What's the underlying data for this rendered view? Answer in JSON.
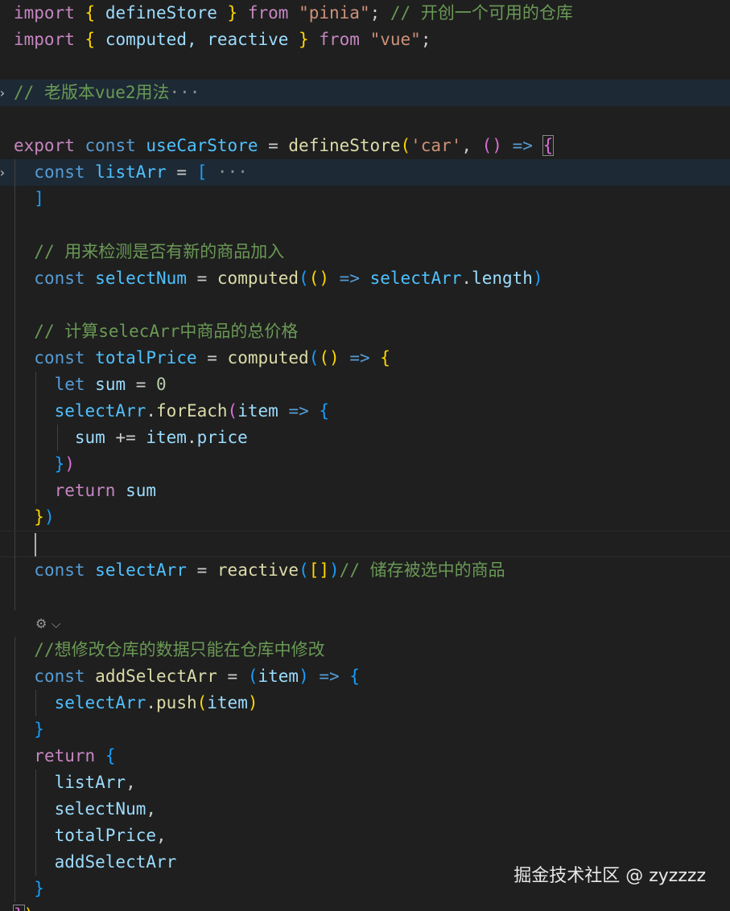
{
  "editor": {
    "lines": [
      {
        "fold": "",
        "guides": [],
        "tokens": [
          {
            "t": "import",
            "c": "kw-purple"
          },
          {
            "t": " ",
            "c": "plain"
          },
          {
            "t": "{",
            "c": "br1"
          },
          {
            "t": " defineStore ",
            "c": "var"
          },
          {
            "t": "}",
            "c": "br1"
          },
          {
            "t": " ",
            "c": "plain"
          },
          {
            "t": "from",
            "c": "kw-purple"
          },
          {
            "t": " ",
            "c": "plain"
          },
          {
            "t": "\"pinia\"",
            "c": "str"
          },
          {
            "t": "; ",
            "c": "plain"
          },
          {
            "t": "// 开创一个可用的仓库",
            "c": "cm"
          }
        ]
      },
      {
        "fold": "",
        "guides": [],
        "tokens": [
          {
            "t": "import",
            "c": "kw-purple"
          },
          {
            "t": " ",
            "c": "plain"
          },
          {
            "t": "{",
            "c": "br1"
          },
          {
            "t": " computed, reactive ",
            "c": "var"
          },
          {
            "t": "}",
            "c": "br1"
          },
          {
            "t": " ",
            "c": "plain"
          },
          {
            "t": "from",
            "c": "kw-purple"
          },
          {
            "t": " ",
            "c": "plain"
          },
          {
            "t": "\"vue\"",
            "c": "str"
          },
          {
            "t": ";",
            "c": "plain"
          }
        ]
      },
      {
        "fold": "",
        "guides": [],
        "tokens": []
      },
      {
        "fold": "›",
        "guides": [],
        "hl": true,
        "tokens": [
          {
            "t": "// 老版本vue2用法",
            "c": "cm"
          },
          {
            "t": "···",
            "c": "ellipsis"
          }
        ]
      },
      {
        "fold": "",
        "guides": [],
        "tokens": []
      },
      {
        "fold": "",
        "guides": [],
        "tokens": [
          {
            "t": "export",
            "c": "kw-purple"
          },
          {
            "t": " ",
            "c": "plain"
          },
          {
            "t": "const",
            "c": "kw-blue"
          },
          {
            "t": " ",
            "c": "plain"
          },
          {
            "t": "useCarStore",
            "c": "const"
          },
          {
            "t": " = ",
            "c": "plain"
          },
          {
            "t": "defineStore",
            "c": "fn"
          },
          {
            "t": "(",
            "c": "br1"
          },
          {
            "t": "'car'",
            "c": "str"
          },
          {
            "t": ", ",
            "c": "plain"
          },
          {
            "t": "()",
            "c": "br2"
          },
          {
            "t": " ",
            "c": "plain"
          },
          {
            "t": "=>",
            "c": "kw-blue"
          },
          {
            "t": " ",
            "c": "plain"
          },
          {
            "t": "{",
            "c": "br2",
            "box": true
          }
        ]
      },
      {
        "fold": "›",
        "guides": [
          1
        ],
        "hl": true,
        "tokens": [
          {
            "t": "  ",
            "c": "plain"
          },
          {
            "t": "const",
            "c": "kw-blue"
          },
          {
            "t": " ",
            "c": "plain"
          },
          {
            "t": "listArr",
            "c": "const"
          },
          {
            "t": " = ",
            "c": "plain"
          },
          {
            "t": "[",
            "c": "br3"
          },
          {
            "t": " ···",
            "c": "ellipsis"
          }
        ]
      },
      {
        "fold": "",
        "guides": [
          1
        ],
        "tokens": [
          {
            "t": "  ",
            "c": "plain"
          },
          {
            "t": "]",
            "c": "br3"
          }
        ]
      },
      {
        "fold": "",
        "guides": [
          1
        ],
        "tokens": []
      },
      {
        "fold": "",
        "guides": [
          1
        ],
        "tokens": [
          {
            "t": "  ",
            "c": "plain"
          },
          {
            "t": "// 用来检测是否有新的商品加入",
            "c": "cm"
          }
        ]
      },
      {
        "fold": "",
        "guides": [
          1
        ],
        "tokens": [
          {
            "t": "  ",
            "c": "plain"
          },
          {
            "t": "const",
            "c": "kw-blue"
          },
          {
            "t": " ",
            "c": "plain"
          },
          {
            "t": "selectNum",
            "c": "const"
          },
          {
            "t": " = ",
            "c": "plain"
          },
          {
            "t": "computed",
            "c": "fn"
          },
          {
            "t": "(",
            "c": "br3"
          },
          {
            "t": "()",
            "c": "br1"
          },
          {
            "t": " ",
            "c": "plain"
          },
          {
            "t": "=>",
            "c": "kw-blue"
          },
          {
            "t": " ",
            "c": "plain"
          },
          {
            "t": "selectArr",
            "c": "const"
          },
          {
            "t": ".",
            "c": "plain"
          },
          {
            "t": "length",
            "c": "var"
          },
          {
            "t": ")",
            "c": "br3"
          }
        ]
      },
      {
        "fold": "",
        "guides": [
          1
        ],
        "tokens": []
      },
      {
        "fold": "",
        "guides": [
          1
        ],
        "tokens": [
          {
            "t": "  ",
            "c": "plain"
          },
          {
            "t": "// 计算selecArr中商品的总价格",
            "c": "cm"
          }
        ]
      },
      {
        "fold": "",
        "guides": [
          1
        ],
        "tokens": [
          {
            "t": "  ",
            "c": "plain"
          },
          {
            "t": "const",
            "c": "kw-blue"
          },
          {
            "t": " ",
            "c": "plain"
          },
          {
            "t": "totalPrice",
            "c": "const"
          },
          {
            "t": " = ",
            "c": "plain"
          },
          {
            "t": "computed",
            "c": "fn"
          },
          {
            "t": "(",
            "c": "br3"
          },
          {
            "t": "()",
            "c": "br1"
          },
          {
            "t": " ",
            "c": "plain"
          },
          {
            "t": "=>",
            "c": "kw-blue"
          },
          {
            "t": " ",
            "c": "plain"
          },
          {
            "t": "{",
            "c": "br1"
          }
        ]
      },
      {
        "fold": "",
        "guides": [
          1,
          2
        ],
        "tokens": [
          {
            "t": "    ",
            "c": "plain"
          },
          {
            "t": "let",
            "c": "kw-blue"
          },
          {
            "t": " ",
            "c": "plain"
          },
          {
            "t": "sum",
            "c": "var"
          },
          {
            "t": " = ",
            "c": "plain"
          },
          {
            "t": "0",
            "c": "num"
          }
        ]
      },
      {
        "fold": "",
        "guides": [
          1,
          2
        ],
        "tokens": [
          {
            "t": "    ",
            "c": "plain"
          },
          {
            "t": "selectArr",
            "c": "const"
          },
          {
            "t": ".",
            "c": "plain"
          },
          {
            "t": "forEach",
            "c": "fn"
          },
          {
            "t": "(",
            "c": "br2"
          },
          {
            "t": "item",
            "c": "var"
          },
          {
            "t": " ",
            "c": "plain"
          },
          {
            "t": "=>",
            "c": "kw-blue"
          },
          {
            "t": " ",
            "c": "plain"
          },
          {
            "t": "{",
            "c": "br3"
          }
        ]
      },
      {
        "fold": "",
        "guides": [
          1,
          2,
          3
        ],
        "tokens": [
          {
            "t": "      ",
            "c": "plain"
          },
          {
            "t": "sum",
            "c": "var"
          },
          {
            "t": " += ",
            "c": "plain"
          },
          {
            "t": "item",
            "c": "var"
          },
          {
            "t": ".",
            "c": "plain"
          },
          {
            "t": "price",
            "c": "var"
          }
        ]
      },
      {
        "fold": "",
        "guides": [
          1,
          2
        ],
        "tokens": [
          {
            "t": "    ",
            "c": "plain"
          },
          {
            "t": "}",
            "c": "br3"
          },
          {
            "t": ")",
            "c": "br2"
          }
        ]
      },
      {
        "fold": "",
        "guides": [
          1,
          2
        ],
        "tokens": [
          {
            "t": "    ",
            "c": "plain"
          },
          {
            "t": "return",
            "c": "kw-purple"
          },
          {
            "t": " ",
            "c": "plain"
          },
          {
            "t": "sum",
            "c": "var"
          }
        ]
      },
      {
        "fold": "",
        "guides": [
          1
        ],
        "tokens": [
          {
            "t": "  ",
            "c": "plain"
          },
          {
            "t": "}",
            "c": "br1"
          },
          {
            "t": ")",
            "c": "br3"
          }
        ]
      },
      {
        "fold": "",
        "guides": [
          1
        ],
        "cur": true,
        "caret": true,
        "tokens": []
      },
      {
        "fold": "",
        "guides": [
          1
        ],
        "tokens": [
          {
            "t": "  ",
            "c": "plain"
          },
          {
            "t": "const",
            "c": "kw-blue"
          },
          {
            "t": " ",
            "c": "plain"
          },
          {
            "t": "selectArr",
            "c": "const"
          },
          {
            "t": " = ",
            "c": "plain"
          },
          {
            "t": "reactive",
            "c": "fn"
          },
          {
            "t": "(",
            "c": "br3"
          },
          {
            "t": "[]",
            "c": "br1"
          },
          {
            "t": ")",
            "c": "br3"
          },
          {
            "t": "// 储存被选中的商品",
            "c": "cm"
          }
        ]
      },
      {
        "fold": "",
        "guides": [
          1
        ],
        "tokens": []
      },
      {
        "fold": "",
        "guides": [],
        "lens": true,
        "tokens": []
      },
      {
        "fold": "",
        "guides": [
          1
        ],
        "tokens": [
          {
            "t": "  ",
            "c": "plain"
          },
          {
            "t": "//想修改仓库的数据只能在仓库中修改",
            "c": "cm"
          }
        ]
      },
      {
        "fold": "",
        "guides": [
          1
        ],
        "tokens": [
          {
            "t": "  ",
            "c": "plain"
          },
          {
            "t": "const",
            "c": "kw-blue"
          },
          {
            "t": " ",
            "c": "plain"
          },
          {
            "t": "addSelectArr",
            "c": "fn"
          },
          {
            "t": " = ",
            "c": "plain"
          },
          {
            "t": "(",
            "c": "br3"
          },
          {
            "t": "item",
            "c": "var"
          },
          {
            "t": ")",
            "c": "br3"
          },
          {
            "t": " ",
            "c": "plain"
          },
          {
            "t": "=>",
            "c": "kw-blue"
          },
          {
            "t": " ",
            "c": "plain"
          },
          {
            "t": "{",
            "c": "br3"
          }
        ]
      },
      {
        "fold": "",
        "guides": [
          1,
          2
        ],
        "tokens": [
          {
            "t": "    ",
            "c": "plain"
          },
          {
            "t": "selectArr",
            "c": "const"
          },
          {
            "t": ".",
            "c": "plain"
          },
          {
            "t": "push",
            "c": "fn"
          },
          {
            "t": "(",
            "c": "br1"
          },
          {
            "t": "item",
            "c": "var"
          },
          {
            "t": ")",
            "c": "br1"
          }
        ]
      },
      {
        "fold": "",
        "guides": [
          1
        ],
        "tokens": [
          {
            "t": "  ",
            "c": "plain"
          },
          {
            "t": "}",
            "c": "br3"
          }
        ]
      },
      {
        "fold": "",
        "guides": [
          1
        ],
        "tokens": [
          {
            "t": "  ",
            "c": "plain"
          },
          {
            "t": "return",
            "c": "kw-purple"
          },
          {
            "t": " ",
            "c": "plain"
          },
          {
            "t": "{",
            "c": "br3"
          }
        ]
      },
      {
        "fold": "",
        "guides": [
          1,
          2
        ],
        "tokens": [
          {
            "t": "    ",
            "c": "plain"
          },
          {
            "t": "listArr",
            "c": "var"
          },
          {
            "t": ",",
            "c": "plain"
          }
        ]
      },
      {
        "fold": "",
        "guides": [
          1,
          2
        ],
        "tokens": [
          {
            "t": "    ",
            "c": "plain"
          },
          {
            "t": "selectNum",
            "c": "var"
          },
          {
            "t": ",",
            "c": "plain"
          }
        ]
      },
      {
        "fold": "",
        "guides": [
          1,
          2
        ],
        "tokens": [
          {
            "t": "    ",
            "c": "plain"
          },
          {
            "t": "totalPrice",
            "c": "var"
          },
          {
            "t": ",",
            "c": "plain"
          }
        ]
      },
      {
        "fold": "",
        "guides": [
          1,
          2
        ],
        "tokens": [
          {
            "t": "    ",
            "c": "plain"
          },
          {
            "t": "addSelectArr",
            "c": "var"
          }
        ]
      },
      {
        "fold": "",
        "guides": [
          1
        ],
        "tokens": [
          {
            "t": "  ",
            "c": "plain"
          },
          {
            "t": "}",
            "c": "br3"
          }
        ]
      },
      {
        "fold": "",
        "guides": [],
        "tokens": [
          {
            "t": "}",
            "c": "br2",
            "box": true
          },
          {
            "t": ")",
            "c": "br1"
          }
        ]
      }
    ]
  },
  "codelens": {
    "icon": "copilot-icon",
    "icon_glyph": "⚙",
    "chevron": "⌵"
  },
  "watermark": {
    "text": "掘金技术社区 @ zyzzzz"
  },
  "colors": {
    "background": "#1f1f1f",
    "keyword_purple": "#c586c0",
    "keyword_blue": "#569cd6",
    "function": "#dcdcaa",
    "variable": "#9cdcfe",
    "constant": "#4fc1ff",
    "string": "#ce9178",
    "comment": "#6a9955",
    "number": "#b5cea8"
  }
}
